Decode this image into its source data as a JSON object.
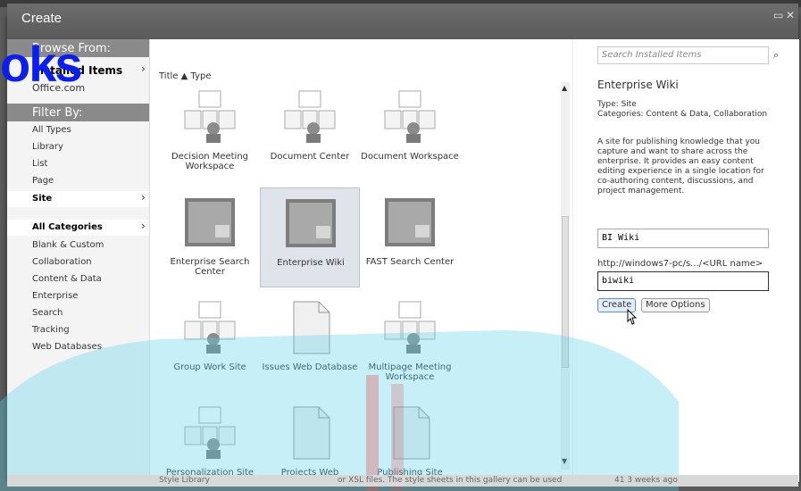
{
  "dialog": {
    "title": "Create",
    "maximize_icon": "maximize-icon",
    "close_icon": "close-icon"
  },
  "left": {
    "browse_header": "Browse From:",
    "installed_items": "Installed Items",
    "office_com": "Office.com",
    "filter_header": "Filter By:",
    "types": [
      "All Types",
      "Library",
      "List",
      "Page",
      "Site"
    ],
    "categories": [
      "All Categories",
      "Blank & Custom",
      "Collaboration",
      "Content & Data",
      "Enterprise",
      "Search",
      "Tracking",
      "Web Databases"
    ]
  },
  "overlay": {
    "text": "oks"
  },
  "middle": {
    "sort_title": "Title",
    "sort_type": "Type",
    "tiles": [
      {
        "label": "Decision Meeting Workspace",
        "icon": "decision-meeting-icon"
      },
      {
        "label": "Document Center",
        "icon": "document-center-icon"
      },
      {
        "label": "Document Workspace",
        "icon": "document-workspace-icon"
      },
      {
        "label": "Enterprise Search Center",
        "icon": "enterprise-search-center-icon"
      },
      {
        "label": "Enterprise Wiki",
        "icon": "enterprise-wiki-icon"
      },
      {
        "label": "FAST Search Center",
        "icon": "fast-search-center-icon"
      },
      {
        "label": "Group Work Site",
        "icon": "group-work-site-icon"
      },
      {
        "label": "Issues Web Database",
        "icon": "issues-web-database-icon"
      },
      {
        "label": "Multipage Meeting Workspace",
        "icon": "multipage-meeting-icon"
      },
      {
        "label": "Personalization Site",
        "icon": "personalization-site-icon"
      },
      {
        "label": "Projects Web",
        "icon": "projects-web-icon"
      },
      {
        "label": "Publishing Site",
        "icon": "publishing-site-icon"
      }
    ]
  },
  "right": {
    "search_placeholder": "Search Installed Items",
    "title": "Enterprise Wiki",
    "type_line": "Type: Site",
    "categories_line": "Categories: Content & Data, Collaboration",
    "description": "A site for publishing knowledge that you capture and want to share across the enterprise. It provides an easy content editing experience in a single location for co-authoring content, discussions, and project management.",
    "name_value": "BI Wiki",
    "url_label": "http://windows7-pc/s.../<URL name>",
    "url_value": "biwiki",
    "create_label": "Create",
    "more_options_label": "More Options"
  },
  "bottom": {
    "left_text": "Style Library",
    "mid_text": "or XSL files. The style sheets in this gallery can be used",
    "right_text": "41  3 weeks ago"
  },
  "colors": {
    "titlebar": "#5f5f5f",
    "overlay_text": "#0a1ef0",
    "watermark_cyan": "#5fd0e8",
    "watermark_red": "#e05555"
  }
}
